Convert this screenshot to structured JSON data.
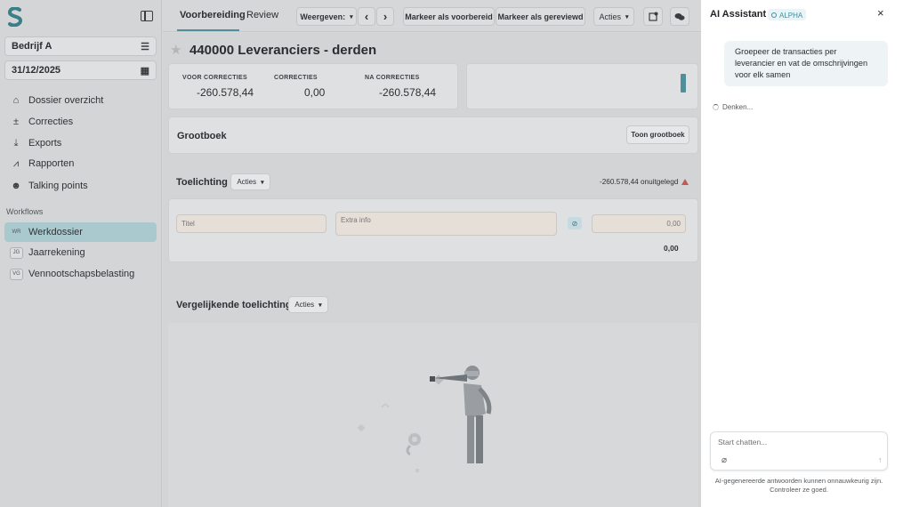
{
  "sidebar": {
    "company": "Bedrijf A",
    "date": "31/12/2025",
    "nav": [
      {
        "label": "Dossier overzicht",
        "icon": "home-icon"
      },
      {
        "label": "Correcties",
        "icon": "plus-minus-icon"
      },
      {
        "label": "Exports",
        "icon": "download-icon"
      },
      {
        "label": "Rapporten",
        "icon": "chart-icon"
      },
      {
        "label": "Talking points",
        "icon": "people-icon"
      }
    ],
    "workflows_title": "Workflows",
    "workflows": [
      {
        "badge": "WR",
        "label": "Werkdossier",
        "active": true
      },
      {
        "badge": "JG",
        "label": "Jaarrekening",
        "active": false
      },
      {
        "badge": "VG",
        "label": "Vennootschapsbelasting",
        "active": false
      }
    ]
  },
  "topbar": {
    "tabs": [
      "Voorbereiding",
      "Review"
    ],
    "view_label": "Weergeven:",
    "prev": "‹",
    "next": "›",
    "mark_prepared": "Markeer als voorbereid",
    "mark_reviewed": "Markeer als gereviewd",
    "actions": "Acties"
  },
  "main": {
    "title": "440000 Leveranciers - derden",
    "stats": [
      {
        "label": "VOOR CORRECTIES",
        "value": "-260.578,44"
      },
      {
        "label": "CORRECTIES",
        "value": "0,00"
      },
      {
        "label": "NA CORRECTIES",
        "value": "-260.578,44"
      }
    ],
    "grootboek": {
      "title": "Grootboek",
      "button": "Toon grootboek"
    },
    "toelichting": {
      "title": "Toelichting",
      "actions": "Acties",
      "unexplained": "-260.578,44 onuitgelegd",
      "title_placeholder": "Titel",
      "extra_placeholder": "Extra info",
      "amount_placeholder": "0,00",
      "total": "0,00"
    },
    "vergelijkende": {
      "title": "Vergelijkende toelichting",
      "actions": "Acties"
    }
  },
  "ai": {
    "title": "AI Assistant",
    "badge": "ALPHA",
    "close": "×",
    "user_message": "Groepeer de transacties per leverancier en vat de omschrijvingen voor elk samen",
    "thinking": "Denken...",
    "input_placeholder": "Start chatten...",
    "disclaimer": "AI-gegenereerde antwoorden kunnen onnauwkeurig zijn. Controleer ze goed."
  },
  "colors": {
    "accent": "#4f8f99",
    "active_row": "#a9c9ce",
    "warning": "#c05a52"
  }
}
